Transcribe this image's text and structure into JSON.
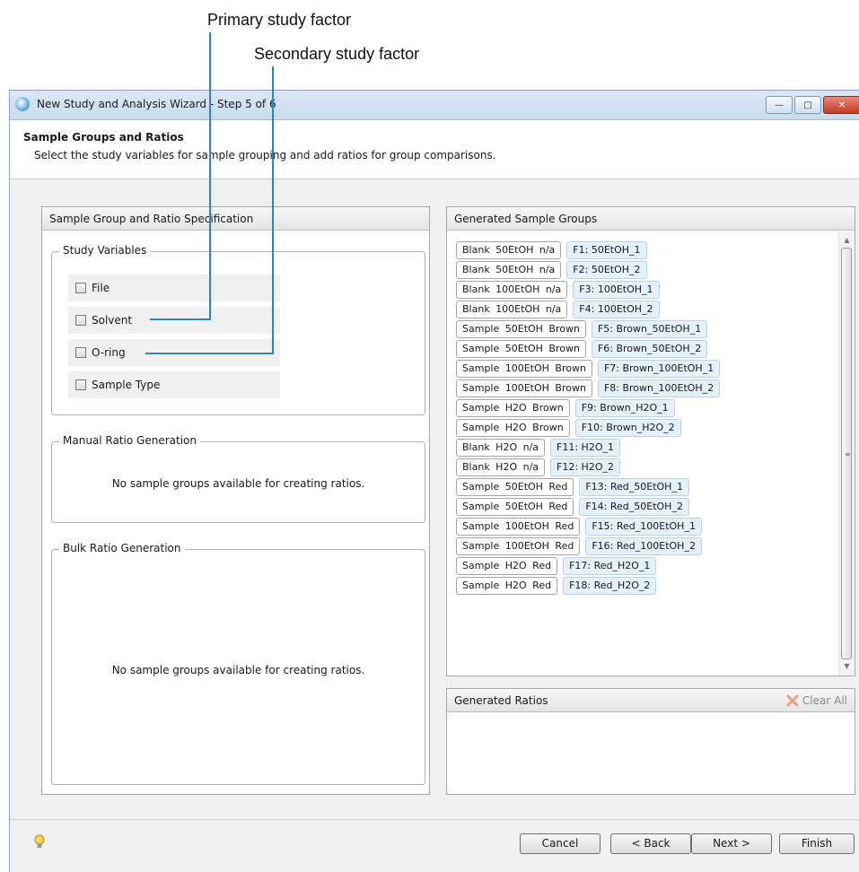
{
  "callouts": {
    "primary": "Primary study factor",
    "secondary": "Secondary study factor"
  },
  "window": {
    "title": "New Study and Analysis Wizard - Step 5 of 6",
    "minimize_icon": "minimize-icon",
    "maximize_icon": "maximize-icon",
    "close_icon": "close-icon"
  },
  "header": {
    "title": "Sample Groups and Ratios",
    "description": "Select the study variables for sample grouping and add ratios for group comparisons."
  },
  "left_panel": {
    "title": "Sample Group and Ratio Specification",
    "study_variables": {
      "legend": "Study Variables",
      "items": [
        {
          "label": "File",
          "checked": false
        },
        {
          "label": "Solvent",
          "checked": false
        },
        {
          "label": "O-ring",
          "checked": false
        },
        {
          "label": "Sample Type",
          "checked": false
        }
      ]
    },
    "manual_ratio": {
      "legend": "Manual Ratio Generation",
      "message": "No sample groups available for creating ratios."
    },
    "bulk_ratio": {
      "legend": "Bulk Ratio Generation",
      "message": "No sample groups available for creating ratios."
    }
  },
  "sample_groups": {
    "title": "Generated Sample Groups",
    "rows": [
      {
        "chip": "Blank 50EtOH n/a",
        "label": "F1: 50EtOH_1"
      },
      {
        "chip": "Blank 50EtOH n/a",
        "label": "F2: 50EtOH_2"
      },
      {
        "chip": "Blank 100EtOH n/a",
        "label": "F3: 100EtOH_1"
      },
      {
        "chip": "Blank 100EtOH n/a",
        "label": "F4: 100EtOH_2"
      },
      {
        "chip": "Sample 50EtOH Brown",
        "label": "F5: Brown_50EtOH_1"
      },
      {
        "chip": "Sample 50EtOH Brown",
        "label": "F6: Brown_50EtOH_2"
      },
      {
        "chip": "Sample 100EtOH Brown",
        "label": "F7: Brown_100EtOH_1"
      },
      {
        "chip": "Sample 100EtOH Brown",
        "label": "F8: Brown_100EtOH_2"
      },
      {
        "chip": "Sample H2O Brown",
        "label": "F9: Brown_H2O_1"
      },
      {
        "chip": "Sample H2O Brown",
        "label": "F10: Brown_H2O_2"
      },
      {
        "chip": "Blank H2O n/a",
        "label": "F11: H2O_1"
      },
      {
        "chip": "Blank H2O n/a",
        "label": "F12: H2O_2"
      },
      {
        "chip": "Sample 50EtOH Red",
        "label": "F13: Red_50EtOH_1"
      },
      {
        "chip": "Sample 50EtOH Red",
        "label": "F14: Red_50EtOH_2"
      },
      {
        "chip": "Sample 100EtOH Red",
        "label": "F15: Red_100EtOH_1"
      },
      {
        "chip": "Sample 100EtOH Red",
        "label": "F16: Red_100EtOH_2"
      },
      {
        "chip": "Sample H2O Red",
        "label": "F17: Red_H2O_1"
      },
      {
        "chip": "Sample H2O Red",
        "label": "F18: Red_H2O_2"
      }
    ]
  },
  "ratios": {
    "title": "Generated Ratios",
    "clear_all": "Clear All",
    "clear_icon": "clear-all-icon"
  },
  "footer": {
    "hint_icon": "lightbulb-icon",
    "cancel": "Cancel",
    "back": "< Back",
    "next": "Next >",
    "finish": "Finish"
  },
  "colors": {
    "callout_line": "#2a86c8",
    "label_bg": "#e4f0fb"
  }
}
